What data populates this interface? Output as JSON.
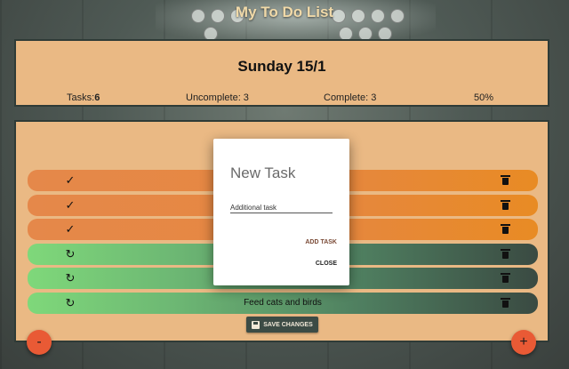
{
  "app": {
    "title": "My To Do List"
  },
  "header": {
    "date": "Sunday 15/1",
    "tasks_label": "Tasks:",
    "tasks_count": "6",
    "uncomplete": "Uncomplete: 3",
    "complete": "Complete: 3",
    "percent": "50%"
  },
  "tasks": [
    {
      "text": "",
      "status": "complete",
      "status_icon": "check-icon",
      "delete_icon": "trash-icon"
    },
    {
      "text": "",
      "status": "complete",
      "status_icon": "check-icon",
      "delete_icon": "trash-icon"
    },
    {
      "text": "",
      "status": "complete",
      "status_icon": "check-icon",
      "delete_icon": "trash-icon"
    },
    {
      "text": "",
      "status": "uncomplete",
      "status_icon": "refresh-icon",
      "delete_icon": "trash-icon"
    },
    {
      "text": "",
      "status": "uncomplete",
      "status_icon": "refresh-icon",
      "delete_icon": "trash-icon"
    },
    {
      "text": "Feed cats and birds",
      "status": "uncomplete",
      "status_icon": "refresh-icon",
      "delete_icon": "trash-icon"
    }
  ],
  "actions": {
    "save_label": "SAVE CHANGES",
    "remove_fab": "-",
    "add_fab": "+"
  },
  "modal": {
    "title": "New Task",
    "input_value": "Additional task",
    "add_label": "ADD TASK",
    "close_label": "CLOSE"
  },
  "colors": {
    "card": "#eab984",
    "complete_row": "#e6873f",
    "uncomplete_row_start": "#7fd87a",
    "fab": "#e95a35",
    "save_button": "#3c4b45"
  }
}
